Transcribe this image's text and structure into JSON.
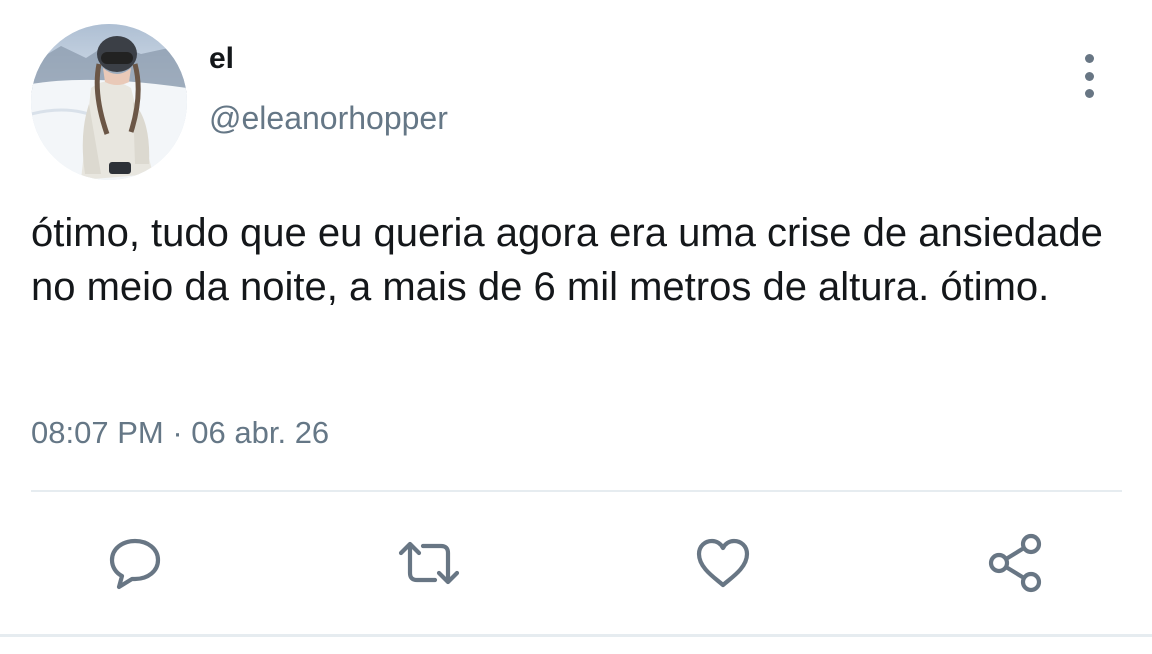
{
  "author": {
    "display_name": "el",
    "handle": "@eleanorhopper"
  },
  "tweet": {
    "text": "ótimo, tudo que eu queria agora era uma crise de ansiedade no meio da noite, a mais de 6 mil metros de altura. ótimo.",
    "time": "08:07 PM",
    "separator": "·",
    "date": "06 abr. 26"
  },
  "actions": [
    {
      "name": "reply",
      "icon": "reply-icon"
    },
    {
      "name": "retweet",
      "icon": "retweet-icon"
    },
    {
      "name": "like",
      "icon": "heart-icon"
    },
    {
      "name": "share",
      "icon": "share-icon"
    }
  ],
  "menu": {
    "icon": "more-vertical-icon"
  },
  "colors": {
    "text": "#14171a",
    "secondary": "#657786",
    "icon": "#687684",
    "divider": "#e6ecf0"
  }
}
